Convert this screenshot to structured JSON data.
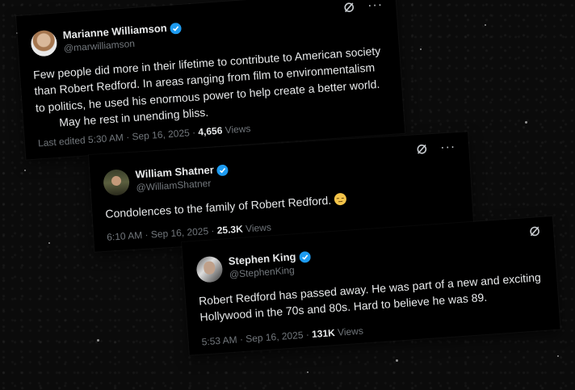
{
  "tweets": [
    {
      "name": "Marianne Williamson",
      "handle": "@marwilliamson",
      "body_line1": "Few people did more in their lifetime to contribute to American society than Robert Redford. In areas ranging from film to environmentalism to politics, he used his enormous power to help create a better world.",
      "body_line2": "May he rest in unending bliss.",
      "meta_prefix": "Last edited 5:30 AM · Sep 16, 2025 · ",
      "views_count": "4,656",
      "views_label": "Views"
    },
    {
      "name": "William Shatner",
      "handle": "@WilliamShatner",
      "body_line1": "Condolences to the family of Robert Redford.",
      "meta_prefix": "6:10 AM · Sep 16, 2025 · ",
      "views_count": "25.3K",
      "views_label": "Views"
    },
    {
      "name": "Stephen King",
      "handle": "@StephenKing",
      "body_line1": "Robert Redford has passed away. He was part of a new and exciting Hollywood in the 70s and 80s. Hard to believe he was 89.",
      "meta_prefix": "5:53 AM · Sep 16, 2025 · ",
      "views_count": "131K",
      "views_label": "Views"
    }
  ],
  "icons": {
    "more": "···",
    "grok": "grok-icon",
    "verified": "verified-icon",
    "emoji": "pensive-face"
  },
  "colors": {
    "verified": "#1d9bf0",
    "muted": "#71767b",
    "text": "#e7e9ea",
    "card": "#000000"
  }
}
